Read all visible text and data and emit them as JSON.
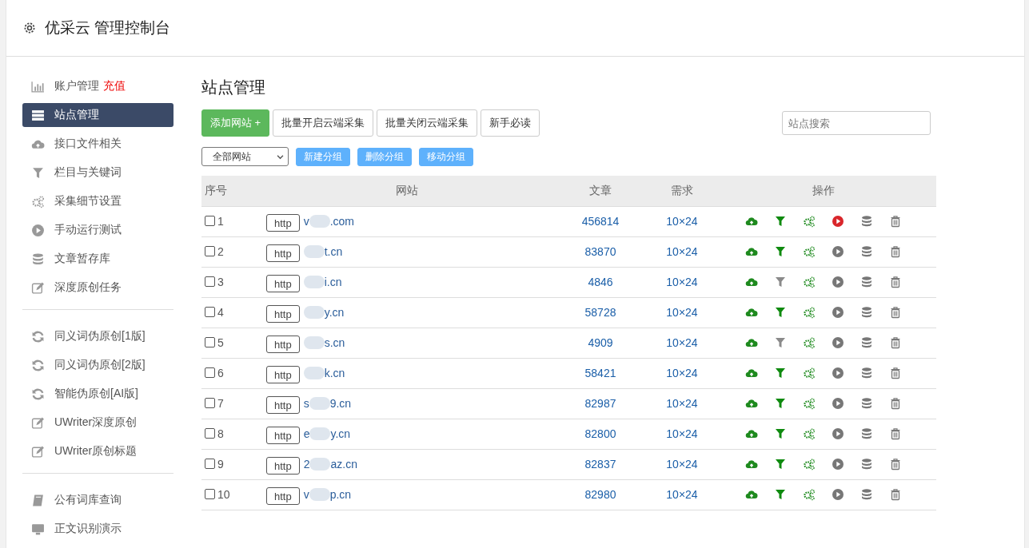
{
  "header": {
    "title": "优采云 管理控制台"
  },
  "sidebar": {
    "groups": [
      [
        {
          "kind": "chart",
          "label": "账户管理",
          "badge": "充值",
          "selected": false
        },
        {
          "kind": "server",
          "label": "站点管理",
          "selected": true
        },
        {
          "kind": "cloud",
          "label": "接口文件相关",
          "selected": false
        },
        {
          "kind": "filter",
          "label": "栏目与关键词",
          "selected": false
        },
        {
          "kind": "gears",
          "label": "采集细节设置",
          "selected": false
        },
        {
          "kind": "play",
          "label": "手动运行测试",
          "selected": false
        },
        {
          "kind": "database",
          "label": "文章暂存库",
          "selected": false
        },
        {
          "kind": "edit",
          "label": "深度原创任务",
          "selected": false
        }
      ],
      [
        {
          "kind": "refresh",
          "label": "同义词伪原创[1版]",
          "selected": false
        },
        {
          "kind": "refresh",
          "label": "同义词伪原创[2版]",
          "selected": false
        },
        {
          "kind": "refresh",
          "label": "智能伪原创[AI版]",
          "selected": false
        },
        {
          "kind": "edit",
          "label": "UWriter深度原创",
          "selected": false
        },
        {
          "kind": "edit",
          "label": "UWriter原创标题",
          "selected": false
        }
      ],
      [
        {
          "kind": "book",
          "label": "公有词库查询",
          "selected": false
        },
        {
          "kind": "monitor",
          "label": "正文识别演示",
          "selected": false
        }
      ]
    ]
  },
  "main": {
    "title": "站点管理",
    "toolbar": [
      {
        "kind": "primary",
        "label": "添加网站 +"
      },
      {
        "kind": "plain",
        "label": "批量开启云端采集"
      },
      {
        "kind": "plain",
        "label": "批量关闭云端采集"
      },
      {
        "kind": "plain",
        "label": "新手必读"
      }
    ],
    "search": {
      "placeholder": "站点搜索"
    },
    "group_select": {
      "value": "全部网站"
    },
    "group_buttons": [
      "新建分组",
      "删除分组",
      "移动分组"
    ],
    "table": {
      "columns": [
        "序号",
        "网站",
        "文章",
        "需求",
        "操作"
      ],
      "rows": [
        {
          "index": "1",
          "protocol": "http",
          "site_prefix": "v",
          "site_suffix": ".com",
          "articles": "456814",
          "demand": "10×24",
          "filter_on": true,
          "running": true,
          "checked": false
        },
        {
          "index": "2",
          "protocol": "http",
          "site_suffix": "t.cn",
          "articles": "83870",
          "demand": "10×24",
          "filter_on": true,
          "running": false,
          "checked": false
        },
        {
          "index": "3",
          "protocol": "http",
          "site_suffix": "i.cn",
          "articles": "4846",
          "demand": "10×24",
          "filter_on": false,
          "running": false,
          "checked": false
        },
        {
          "index": "4",
          "protocol": "http",
          "site_suffix": "y.cn",
          "articles": "58728",
          "demand": "10×24",
          "filter_on": true,
          "running": false,
          "checked": false
        },
        {
          "index": "5",
          "protocol": "http",
          "site_suffix": "s.cn",
          "articles": "4909",
          "demand": "10×24",
          "filter_on": false,
          "running": false,
          "checked": false
        },
        {
          "index": "6",
          "protocol": "http",
          "site_suffix": "k.cn",
          "articles": "58421",
          "demand": "10×24",
          "filter_on": true,
          "running": false,
          "checked": false
        },
        {
          "index": "7",
          "protocol": "http",
          "site_prefix": "s",
          "site_suffix": "9.cn",
          "articles": "82987",
          "demand": "10×24",
          "filter_on": true,
          "running": false,
          "checked": false
        },
        {
          "index": "8",
          "protocol": "http",
          "site_prefix": "e",
          "site_suffix": "y.cn",
          "articles": "82800",
          "demand": "10×24",
          "filter_on": true,
          "running": false,
          "checked": false
        },
        {
          "index": "9",
          "protocol": "http",
          "site_prefix": "2",
          "site_suffix": "az.cn",
          "articles": "82837",
          "demand": "10×24",
          "filter_on": true,
          "running": false,
          "checked": false
        },
        {
          "index": "10",
          "protocol": "http",
          "site_prefix": "v",
          "site_suffix": "p.cn",
          "articles": "82980",
          "demand": "10×24",
          "filter_on": true,
          "running": false,
          "checked": false
        }
      ]
    }
  }
}
